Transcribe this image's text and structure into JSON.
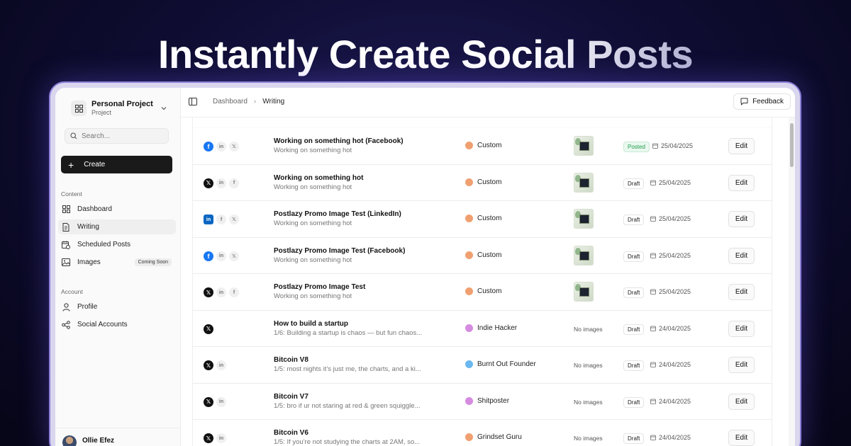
{
  "hero": {
    "title": "Instantly Create Social Posts"
  },
  "sidebar": {
    "project_name": "Personal Project",
    "project_sub": "Project",
    "search_placeholder": "Search...",
    "create_label": "Create",
    "content_label": "Content",
    "account_label": "Account",
    "items": [
      {
        "label": "Dashboard",
        "icon": "grid-icon"
      },
      {
        "label": "Writing",
        "icon": "document-icon",
        "active": true
      },
      {
        "label": "Scheduled Posts",
        "icon": "calendar-clock-icon"
      },
      {
        "label": "Images",
        "icon": "image-icon",
        "badge": "Coming Soon"
      }
    ],
    "account_items": [
      {
        "label": "Profile",
        "icon": "user-icon"
      },
      {
        "label": "Social Accounts",
        "icon": "share-icon"
      }
    ],
    "user_name": "Ollie Efez"
  },
  "topbar": {
    "breadcrumb_root": "Dashboard",
    "breadcrumb_current": "Writing",
    "feedback_label": "Feedback"
  },
  "rows": [
    {
      "platforms": [
        "fb",
        "li",
        "x"
      ],
      "title": "Working on something hot (Facebook)",
      "subtitle": "Working on something hot",
      "persona": "Custom",
      "persona_color": "#f0a070",
      "image": true,
      "status": "Posted",
      "date": "25/04/2025",
      "edit": "Edit"
    },
    {
      "platforms": [
        "x",
        "li",
        "fb"
      ],
      "title": "Working on something hot",
      "subtitle": "Working on something hot",
      "persona": "Custom",
      "persona_color": "#f0a070",
      "image": true,
      "status": "Draft",
      "date": "25/04/2025",
      "edit": "Edit"
    },
    {
      "platforms": [
        "li",
        "fb",
        "x"
      ],
      "title": "Postlazy Promo Image Test (LinkedIn)",
      "subtitle": "Working on something hot",
      "persona": "Custom",
      "persona_color": "#f0a070",
      "image": true,
      "status": "Draft",
      "date": "25/04/2025",
      "edit": "Edit"
    },
    {
      "platforms": [
        "fb",
        "li",
        "x"
      ],
      "title": "Postlazy Promo Image Test (Facebook)",
      "subtitle": "Working on something hot",
      "persona": "Custom",
      "persona_color": "#f0a070",
      "image": true,
      "status": "Draft",
      "date": "25/04/2025",
      "edit": "Edit"
    },
    {
      "platforms": [
        "x",
        "li",
        "fb"
      ],
      "title": "Postlazy Promo Image Test",
      "subtitle": "Working on something hot",
      "persona": "Custom",
      "persona_color": "#f0a070",
      "image": true,
      "status": "Draft",
      "date": "25/04/2025",
      "edit": "Edit"
    },
    {
      "platforms": [
        "x"
      ],
      "title": "How to build a startup",
      "subtitle": "1/6: Building a startup is chaos — but fun chaos...",
      "persona": "Indie Hacker",
      "persona_color": "#d58be0",
      "image": false,
      "no_images": "No images",
      "status": "Draft",
      "date": "24/04/2025",
      "edit": "Edit"
    },
    {
      "platforms": [
        "x",
        "li"
      ],
      "title": "Bitcoin V8",
      "subtitle": "1/5: most nights it's just me, the charts, and a ki...",
      "persona": "Burnt Out Founder",
      "persona_color": "#6ab8f0",
      "image": false,
      "no_images": "No images",
      "status": "Draft",
      "date": "24/04/2025",
      "edit": "Edit"
    },
    {
      "platforms": [
        "x",
        "li"
      ],
      "title": "Bitcoin V7",
      "subtitle": "1/5: bro if ur not staring at red & green squiggle...",
      "persona": "Shitposter",
      "persona_color": "#d58be0",
      "image": false,
      "no_images": "No images",
      "status": "Draft",
      "date": "24/04/2025",
      "edit": "Edit"
    },
    {
      "platforms": [
        "x",
        "li"
      ],
      "title": "Bitcoin V6",
      "subtitle": "1/5: If you're not studying the charts at 2AM, so...",
      "persona": "Grindset Guru",
      "persona_color": "#f0a070",
      "image": false,
      "no_images": "No images",
      "status": "Draft",
      "date": "24/04/2025",
      "edit": "Edit"
    }
  ]
}
